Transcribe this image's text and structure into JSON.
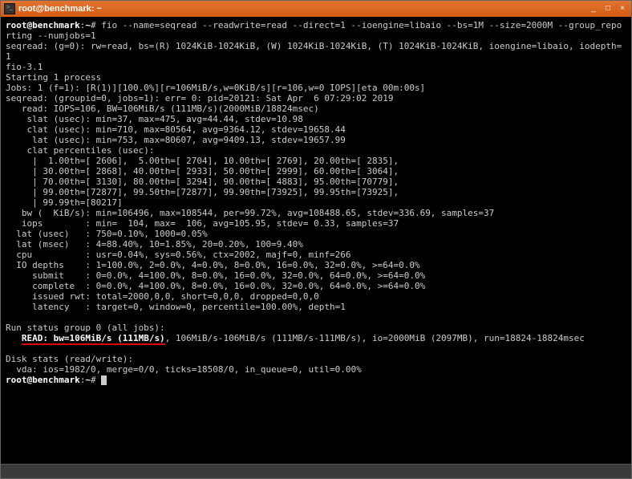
{
  "titlebar": {
    "title": "root@benchmark: ~",
    "min": "_",
    "max": "□",
    "close": "×"
  },
  "prompt": {
    "user_host": "root@benchmark",
    "path": "~",
    "sep1": ":",
    "sep2": "#"
  },
  "command": "fio --name=seqread --readwrite=read --direct=1 --ioengine=libaio --bs=1M --size=2000M --group_reporting --numjobs=1",
  "output_head": "seqread: (g=0): rw=read, bs=(R) 1024KiB-1024KiB, (W) 1024KiB-1024KiB, (T) 1024KiB-1024KiB, ioengine=libaio, iodepth=1\nfio-3.1\nStarting 1 process\nJobs: 1 (f=1): [R(1)][100.0%][r=106MiB/s,w=0KiB/s][r=106,w=0 IOPS][eta 00m:00s]\nseqread: (groupid=0, jobs=1): err= 0: pid=20121: Sat Apr  6 07:29:02 2019\n   read: IOPS=106, BW=106MiB/s (111MB/s)(2000MiB/18824msec)\n    slat (usec): min=37, max=475, avg=44.44, stdev=10.98\n    clat (usec): min=710, max=80564, avg=9364.12, stdev=19658.44\n     lat (usec): min=753, max=80607, avg=9409.13, stdev=19657.99\n    clat percentiles (usec):\n     |  1.00th=[ 2606],  5.00th=[ 2704], 10.00th=[ 2769], 20.00th=[ 2835],\n     | 30.00th=[ 2868], 40.00th=[ 2933], 50.00th=[ 2999], 60.00th=[ 3064],\n     | 70.00th=[ 3130], 80.00th=[ 3294], 90.00th=[ 4883], 95.00th=[70779],\n     | 99.00th=[72877], 99.50th=[72877], 99.90th=[73925], 99.95th=[73925],\n     | 99.99th=[80217]\n   bw (  KiB/s): min=106496, max=108544, per=99.72%, avg=108488.65, stdev=336.69, samples=37\n   iops        : min=  104, max=  106, avg=105.95, stdev= 0.33, samples=37\n  lat (usec)   : 750=0.10%, 1000=0.05%\n  lat (msec)   : 4=88.40%, 10=1.85%, 20=0.20%, 100=9.40%\n  cpu          : usr=0.04%, sys=0.56%, ctx=2002, majf=0, minf=266\n  IO depths    : 1=100.0%, 2=0.0%, 4=0.0%, 8=0.0%, 16=0.0%, 32=0.0%, >=64=0.0%\n     submit    : 0=0.0%, 4=100.0%, 8=0.0%, 16=0.0%, 32=0.0%, 64=0.0%, >=64=0.0%\n     complete  : 0=0.0%, 4=100.0%, 8=0.0%, 16=0.0%, 32=0.0%, 64=0.0%, >=64=0.0%\n     issued rwt: total=2000,0,0, short=0,0,0, dropped=0,0,0\n     latency   : target=0, window=0, percentile=100.00%, depth=1\n\nRun status group 0 (all jobs):",
  "read_line": {
    "indent": "   ",
    "highlight": "READ: bw=106MiB/s (111MB/s)",
    "rest": ", 106MiB/s-106MiB/s (111MB/s-111MB/s), io=2000MiB (2097MB), run=18824-18824msec"
  },
  "output_tail": "\nDisk stats (read/write):\n  vda: ios=1982/0, merge=0/0, ticks=18508/0, in_queue=0, util=0.00%"
}
